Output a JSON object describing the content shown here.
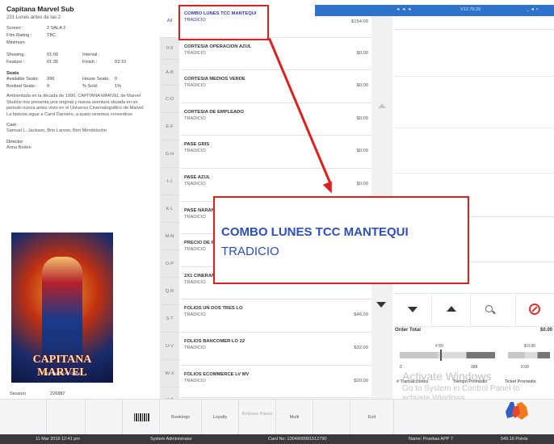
{
  "movie": {
    "title": "Capitana Marvel Sub",
    "subtitle": "231 Lunes antes de las 2",
    "screen_label": "Screen :",
    "screen_value": "2 SALA 2",
    "film_rating_label": "Film Rating :",
    "film_rating_value": "TBC",
    "minimum_label": "Minimum",
    "showing_label": "Showing :",
    "showing_value": "01:00",
    "interval_label": "Interval :",
    "interval_value": "",
    "feature_label": "Feature :",
    "feature_value": "01:35",
    "finish_label": "Finish :",
    "finish_value": "03:10",
    "seats_heading": "Seats",
    "available_label": "Available Seats:",
    "available_value": "396",
    "house_label": "House Seats:",
    "house_value": "0",
    "booked_label": "Booked Seats:",
    "booked_value": "0",
    "sold_label": "% Sold:",
    "sold_value": "1%",
    "description": "Ambientada en la década de 1990, CAPITANA MARVEL de Marvel Studios nos presenta una original y nueva aventura situada en un periodo nunca antes visto en el Universo Cinematográfico de Marvel. La historia sigue a Carol Danvers, a quien veremos convertirse",
    "cast_heading": "Cast",
    "cast": "Samuel L. Jackson, Brie Larson, Ben Mendelsohn",
    "director_heading": "Director",
    "director": "Anna Boden",
    "poster_logo": "CAPITANA MARVEL",
    "poster_tag": "8 DE MARZO EN CINES",
    "session_label": "Session",
    "session_value": "226887"
  },
  "letters": [
    "All",
    "0-9",
    "A-B",
    "C-D",
    "E-F",
    "G-H",
    "I-J",
    "K-L",
    "M-N",
    "O-P",
    "Q-R",
    "S-T",
    "U-V",
    "W-X",
    "Y-Z"
  ],
  "items": [
    {
      "name": "COMBO LUNES TCC MANTEQUI",
      "type": "TRADICIO",
      "price": "$154.00"
    },
    {
      "name": "CORTESIA OPERACION AZUL",
      "type": "TRADICIO",
      "price": "$0.00"
    },
    {
      "name": "CORTESIA MEDIOS VERDE",
      "type": "TRADICIO",
      "price": "$0.00"
    },
    {
      "name": "CORTESIA DE EMPLEADO",
      "type": "TRADICIO",
      "price": "$0.00"
    },
    {
      "name": "PASE GRIS",
      "type": "TRADICIO",
      "price": "$0.00"
    },
    {
      "name": "PASE AZUL",
      "type": "TRADICIO",
      "price": "$0.00"
    },
    {
      "name": "PASE NARANJA",
      "type": "TRADICIO",
      "price": ""
    },
    {
      "name": "PRECIO DE PROMOCION",
      "type": "TRADICIO",
      "price": ""
    },
    {
      "name": "2X1 CINERAMA",
      "type": "TRADICIO",
      "price": ""
    },
    {
      "name": "FOLIOS UN DOS TRES LO",
      "type": "TRADICIO",
      "price": "$46.00"
    },
    {
      "name": "FOLIOS BANCOMER LO 22",
      "type": "TRADICIO",
      "price": "$32.00"
    },
    {
      "name": "FOLIOS ECOMMERCE LV MV",
      "type": "TRADICIO",
      "price": "$20.00"
    }
  ],
  "right": {
    "topbar_left": "◄ ◄ ◄",
    "topbar_mid": "V12.79.29",
    "topbar_right": "_ ◄ ×",
    "order_total_label": "Order Total",
    "order_total_value": "$0.00",
    "gauge1_top": "# 50",
    "gauge1_min": "0",
    "gauge1_mark": "189",
    "gauge2_val": "0.00",
    "gauge3_top": "$ 0.00",
    "transacciones_label": "# Transacciones",
    "tiempo_label": "Tiempo Promedio",
    "ticket_label": "Ticket Promedio",
    "watermark_1": "Activate Windows",
    "watermark_2": "Go to System in Control Panel to activate Windows."
  },
  "toolbar": {
    "bookings": "Bookings",
    "loyalty": "Loyalty",
    "release_pause": "Release Pause",
    "multi": "Multi",
    "exit": "Exit"
  },
  "status": {
    "datetime": "11 Mar 2019 12:41 pm",
    "user": "System Administrator",
    "card": "Card No: 1304909991512790",
    "name": "Name: Pruebas APP 7",
    "points": "549.16 Points"
  },
  "callout": {
    "line1": "COMBO LUNES TCC MANTEQUI",
    "line2": "TRADICIO"
  },
  "colors": {
    "highlight_red": "#e01e1e",
    "callout_blue": "#2b4fbd",
    "titlebar_blue": "#2f72c9",
    "status_bar": "#3a3a3c"
  }
}
